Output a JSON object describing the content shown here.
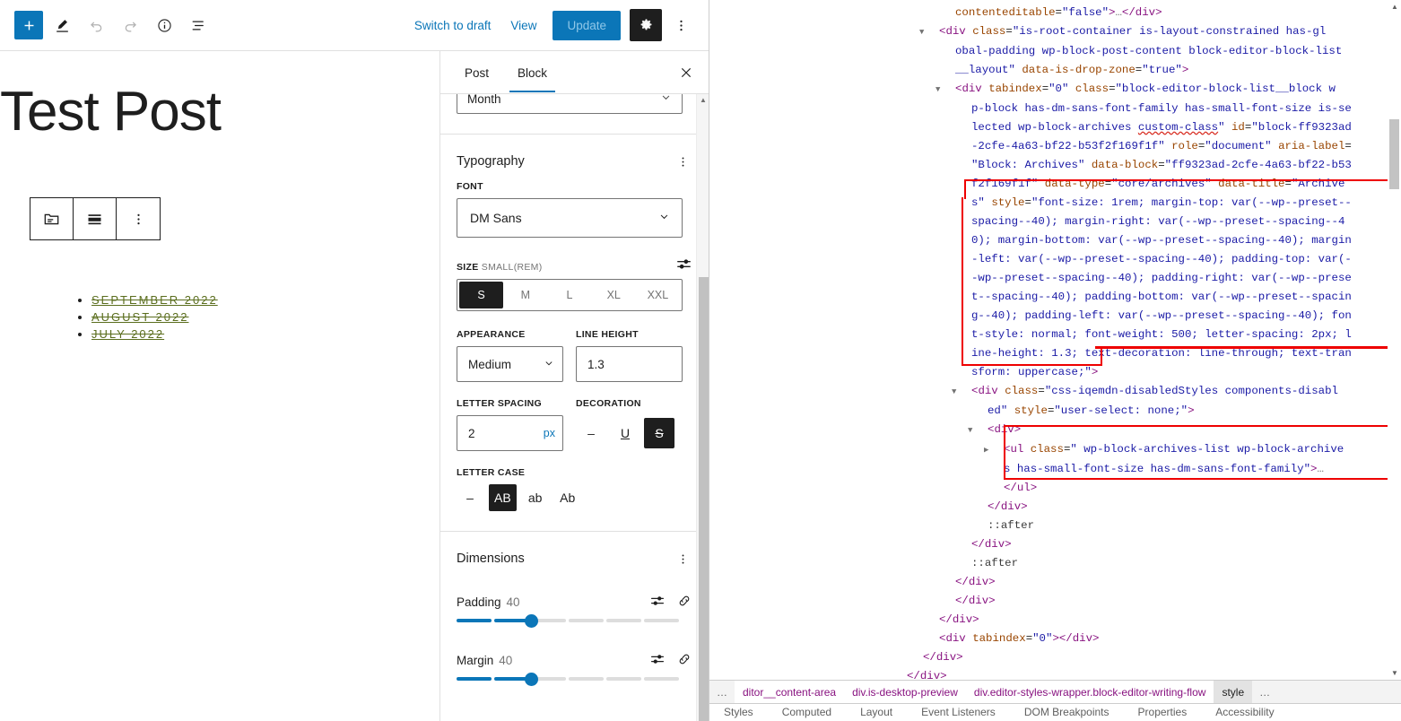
{
  "editor": {
    "header": {
      "add_block_title": "+",
      "tools_icon": "pencil-icon",
      "undo_icon": "undo-icon",
      "redo_icon": "redo-icon",
      "info_icon": "info-icon",
      "list_view_icon": "list-view-icon",
      "switch_to_draft": "Switch to draft",
      "view": "View",
      "update": "Update",
      "settings_icon": "gear-icon",
      "options_icon": "kebab-icon"
    },
    "canvas": {
      "post_title": "Test Post",
      "block_toolbar": {
        "block_type_icon": "archives-block-icon",
        "align_icon": "align-icon",
        "more_icon": "kebab-icon"
      },
      "archives": [
        "September 2022",
        "August 2022",
        "July 2022"
      ]
    },
    "sidebar": {
      "tabs": [
        {
          "label": "Post",
          "active": false
        },
        {
          "label": "Block",
          "active": true
        }
      ],
      "close_icon": "close-icon",
      "group_by": {
        "value": "Month"
      },
      "typography": {
        "title": "Typography",
        "kebab_icon": "kebab-icon",
        "font_label": "FONT",
        "font_value": "DM Sans",
        "size_label": "SIZE",
        "size_sub": "SMALL(REM)",
        "size_options": [
          "S",
          "M",
          "L",
          "XL",
          "XXL"
        ],
        "size_selected": "S",
        "appearance_label": "APPEARANCE",
        "appearance_value": "Medium",
        "line_height_label": "LINE HEIGHT",
        "line_height_value": "1.3",
        "letter_spacing_label": "LETTER SPACING",
        "letter_spacing_value": "2",
        "letter_spacing_unit": "px",
        "decoration_label": "DECORATION",
        "decoration_none": "–",
        "decoration_underline": "U",
        "decoration_strikethrough": "S",
        "decoration_selected": "strikethrough",
        "letter_case_label": "LETTER CASE",
        "case_none": "–",
        "case_upper": "AB",
        "case_lower": "ab",
        "case_capitalize": "Ab",
        "case_selected": "AB"
      },
      "dimensions": {
        "title": "Dimensions",
        "kebab_icon": "kebab-icon",
        "padding_label": "Padding",
        "padding_value": "40",
        "margin_label": "Margin",
        "margin_value": "40",
        "sides_icon": "sliders-icon",
        "link_icon": "link-icon"
      }
    }
  },
  "devtools": {
    "dom_lines": [
      {
        "indent": 1,
        "tri": "",
        "html": "<span class=\"attr\">contenteditable</span><span class=\"plain\">=</span><span class=\"val\">\"false\"</span><span class=\"punc\">&gt;</span><span class=\"ellipsis\">…</span><span class=\"punc\">&lt;/div&gt;</span>"
      },
      {
        "indent": 0,
        "tri": "▼",
        "html": "<span class=\"punc\">&lt;</span><span class=\"tag\">div</span> <span class=\"attr\">class</span><span class=\"plain\">=</span><span class=\"val\">\"is-root-container is-layout-constrained has-gl</span>"
      },
      {
        "indent": 1,
        "tri": "",
        "html": "<span class=\"val\">obal-padding wp-block-post-content block-editor-block-list</span>"
      },
      {
        "indent": 1,
        "tri": "",
        "html": "<span class=\"val\">__layout\"</span> <span class=\"attr\">data-is-drop-zone</span><span class=\"plain\">=</span><span class=\"val\">\"true\"</span><span class=\"punc\">&gt;</span>"
      },
      {
        "indent": 1,
        "tri": "▼",
        "html": "<span class=\"punc\">&lt;</span><span class=\"tag\">div</span> <span class=\"attr\">tabindex</span><span class=\"plain\">=</span><span class=\"val\">\"0\"</span> <span class=\"attr\">class</span><span class=\"plain\">=</span><span class=\"val\">\"block-editor-block-list__block w</span>"
      },
      {
        "indent": 2,
        "tri": "",
        "html": "<span class=\"val\">p-block has-dm-sans-font-family has-small-font-size is-se</span>"
      },
      {
        "indent": 2,
        "tri": "",
        "html": "<span class=\"val\">lected wp-block-archives </span><span class=\"val wavy\">custom-class</span><span class=\"val\">\"</span> <span class=\"attr\">id</span><span class=\"plain\">=</span><span class=\"val\">\"block-ff9323ad</span>"
      },
      {
        "indent": 2,
        "tri": "",
        "html": "<span class=\"val\">-2cfe-4a63-bf22-b53f2f169f1f\"</span> <span class=\"attr\">role</span><span class=\"plain\">=</span><span class=\"val\">\"document\"</span> <span class=\"attr\">aria-label</span><span class=\"plain\">=</span>"
      },
      {
        "indent": 2,
        "tri": "",
        "html": "<span class=\"val\">\"Block: Archives\"</span> <span class=\"attr\">data-block</span><span class=\"plain\">=</span><span class=\"val\">\"ff9323ad-2cfe-4a63-bf22-b53</span>"
      },
      {
        "indent": 2,
        "tri": "",
        "html": "<span class=\"val\">f2f169f1f\"</span> <span class=\"attr\">data-type</span><span class=\"plain\">=</span><span class=\"val\">\"core/archives\"</span> <span class=\"attr\">data-title</span><span class=\"plain\">=</span><span class=\"val\">\"Archive</span>"
      },
      {
        "indent": 2,
        "tri": "",
        "html": "<span class=\"val\">s\"</span> <span class=\"attr\">style</span><span class=\"plain\">=</span><span class=\"val\">\"font-size: 1rem; margin-top: var(--wp--preset--</span>"
      },
      {
        "indent": 2,
        "tri": "",
        "html": "<span class=\"val\">spacing--40); margin-right: var(--wp--preset--spacing--4</span>"
      },
      {
        "indent": 2,
        "tri": "",
        "html": "<span class=\"val\">0); margin-bottom: var(--wp--preset--spacing--40); margin</span>"
      },
      {
        "indent": 2,
        "tri": "",
        "html": "<span class=\"val\">-left: var(--wp--preset--spacing--40); padding-top: var(-</span>"
      },
      {
        "indent": 2,
        "tri": "",
        "html": "<span class=\"val\">-wp--preset--spacing--40); padding-right: var(--wp--prese</span>"
      },
      {
        "indent": 2,
        "tri": "",
        "html": "<span class=\"val\">t--spacing--40); padding-bottom: var(--wp--preset--spacin</span>"
      },
      {
        "indent": 2,
        "tri": "",
        "html": "<span class=\"val\">g--40); padding-left: var(--wp--preset--spacing--40); fon</span>"
      },
      {
        "indent": 2,
        "tri": "",
        "html": "<span class=\"val\">t-style: normal; font-weight: 500; letter-spacing: 2px; l</span>"
      },
      {
        "indent": 2,
        "tri": "",
        "html": "<span class=\"val\">ine-height: 1.3; text-decoration: line-through; text-tran</span>"
      },
      {
        "indent": 2,
        "tri": "",
        "html": "<span class=\"val\">sform: uppercase;\"</span><span class=\"punc\">&gt;</span>"
      },
      {
        "indent": 2,
        "tri": "▼",
        "html": "<span class=\"punc\">&lt;</span><span class=\"tag\">div</span> <span class=\"attr\">class</span><span class=\"plain\">=</span><span class=\"val\">\"css-iqemdn-disabledStyles components-disabl</span>"
      },
      {
        "indent": 3,
        "tri": "",
        "html": "<span class=\"val\">ed\"</span> <span class=\"attr\">style</span><span class=\"plain\">=</span><span class=\"val\">\"user-select: none;\"</span><span class=\"punc\">&gt;</span>"
      },
      {
        "indent": 3,
        "tri": "▼",
        "html": "<span class=\"punc\">&lt;</span><span class=\"tag\">div</span><span class=\"punc\">&gt;</span>"
      },
      {
        "indent": 4,
        "tri": "▶",
        "html": "<span class=\"punc\">&lt;</span><span class=\"tag\">ul</span> <span class=\"attr\">class</span><span class=\"plain\">=</span><span class=\"val\">\" wp-block-archives-list wp-block-archive</span>"
      },
      {
        "indent": 4,
        "tri": "",
        "html": "<span class=\"val\">s has-small-font-size has-dm-sans-font-family\"</span><span class=\"punc\">&gt;</span><span class=\"ellipsis\">…</span>"
      },
      {
        "indent": 4,
        "tri": "",
        "html": "<span class=\"punc\">&lt;/ul&gt;</span>"
      },
      {
        "indent": 3,
        "tri": "",
        "html": "<span class=\"punc\">&lt;/div&gt;</span>"
      },
      {
        "indent": 3,
        "tri": "",
        "html": "<span class=\"plain\" style=\"color:#3b3b3b\">::after</span>"
      },
      {
        "indent": 2,
        "tri": "",
        "html": "<span class=\"punc\">&lt;/div&gt;</span>"
      },
      {
        "indent": 2,
        "tri": "",
        "html": "<span class=\"plain\" style=\"color:#3b3b3b\">::after</span>"
      },
      {
        "indent": 1,
        "tri": "",
        "html": "<span class=\"punc\">&lt;/div&gt;</span>"
      },
      {
        "indent": 1,
        "tri": "",
        "html": "<span class=\"punc\">&lt;/div&gt;</span>"
      },
      {
        "indent": 0,
        "tri": "",
        "html": "<span class=\"punc\">&lt;/div&gt;</span>"
      },
      {
        "indent": 0,
        "tri": "",
        "html": "<span class=\"punc\">&lt;</span><span class=\"tag\">div</span> <span class=\"attr\">tabindex</span><span class=\"plain\">=</span><span class=\"val\">\"0\"</span><span class=\"punc\">&gt;&lt;/div&gt;</span>"
      },
      {
        "indent": -1,
        "tri": "",
        "html": "<span class=\"punc\">&lt;/div&gt;</span>"
      },
      {
        "indent": -2,
        "tri": "",
        "html": "<span class=\"punc\">&lt;/div&gt;</span>"
      }
    ],
    "breadcrumbs": [
      {
        "label": "…",
        "type": "ell"
      },
      {
        "label": "ditor__content-area",
        "type": "node"
      },
      {
        "label": "div.is-desktop-preview",
        "type": "node"
      },
      {
        "label": "div.editor-styles-wrapper.block-editor-writing-flow",
        "type": "node"
      },
      {
        "label": "style",
        "type": "sel"
      },
      {
        "label": "…",
        "type": "ell"
      }
    ],
    "panel_tabs": [
      "Styles",
      "Computed",
      "Layout",
      "Event Listeners",
      "DOM Breakpoints",
      "Properties",
      "Accessibility"
    ]
  },
  "colors": {
    "accent_blue": "#0b76b8",
    "dark": "#1e1e1e",
    "archive_link": "#5b6e1e",
    "highlight_red": "#ee0000"
  }
}
